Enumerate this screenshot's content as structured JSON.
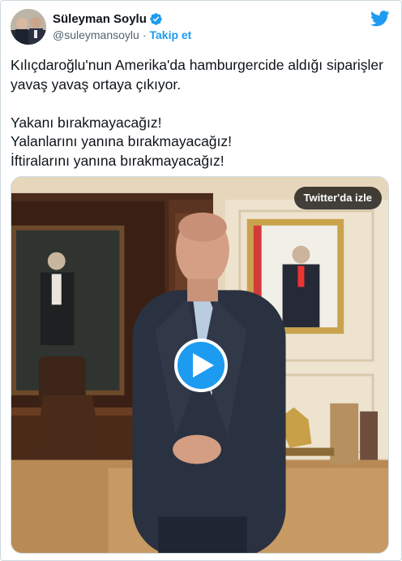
{
  "author": {
    "display_name": "Süleyman Soylu",
    "handle": "@suleymansoylu",
    "separator": "·",
    "follow_label": "Takip et"
  },
  "tweet": {
    "text": "Kılıçdaroğlu'nun Amerika'da hamburgercide aldığı siparişler yavaş yavaş ortaya çıkıyor.\n\nYakanı bırakmayacağız!\nYalanlarını yanına bırakmayacağız!\nİftiralarını yanına bırakmayacağız!"
  },
  "media": {
    "watch_label": "Twitter'da izle"
  },
  "colors": {
    "accent": "#1d9bf0",
    "text": "#0f1419",
    "secondary": "#536471"
  },
  "icons": {
    "brand": "twitter-bird-icon",
    "verified": "verified-badge-icon",
    "play": "play-icon"
  }
}
